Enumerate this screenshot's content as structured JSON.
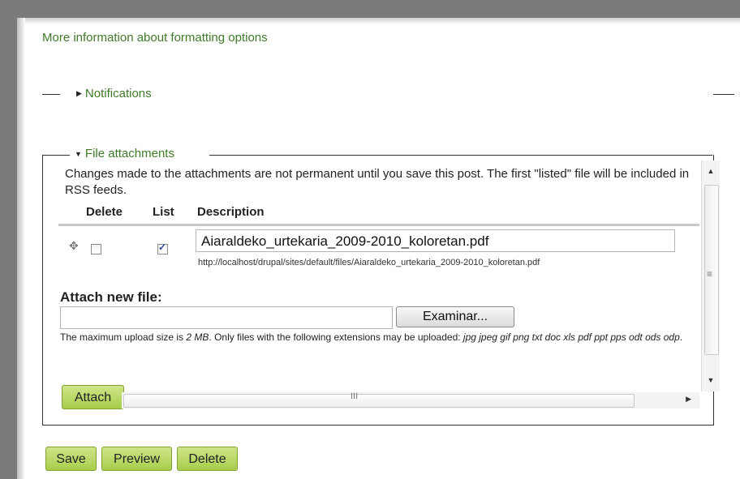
{
  "links": {
    "more_info": "More information about formatting options"
  },
  "fieldsets": {
    "notifications": {
      "label": "Notifications"
    },
    "file_attachments": {
      "label": "File attachments"
    }
  },
  "attachments": {
    "description": "Changes made to the attachments are not permanent until you save this post. The first \"listed\" file will be included in RSS feeds.",
    "columns": {
      "delete": "Delete",
      "list": "List",
      "description": "Description"
    },
    "rows": [
      {
        "delete_checked": false,
        "list_checked": true,
        "description_value": "Aiaraldeko_urtekaria_2009-2010_koloretan.pdf",
        "url": "http://localhost/drupal/sites/default/files/Aiaraldeko_urtekaria_2009-2010_koloretan.pdf"
      }
    ],
    "attach_new_label": "Attach new file:",
    "browse_button": "Examinar...",
    "help_prefix": "The maximum upload size is ",
    "max_size": "2 MB",
    "help_middle": ". Only files with the following extensions may be uploaded: ",
    "extensions": "jpg jpeg gif png txt doc xls pdf ppt pps odt ods odp",
    "help_suffix": ".",
    "attach_button": "Attach"
  },
  "actions": {
    "save": "Save",
    "preview": "Preview",
    "delete": "Delete"
  },
  "icons": {
    "drag": "drag-handle-icon",
    "collapsed": "triangle-right-icon",
    "expanded": "triangle-down-icon"
  },
  "colors": {
    "link_green": "#3f7a2a",
    "button_green": "#b5d55f"
  }
}
